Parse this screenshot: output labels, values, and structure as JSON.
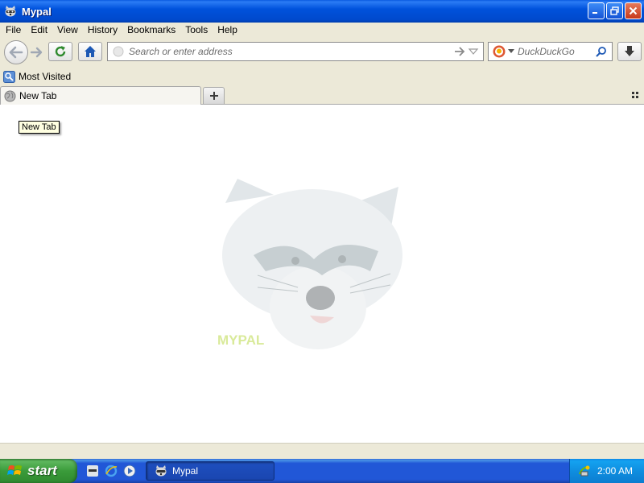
{
  "window": {
    "title": "Mypal"
  },
  "menu": [
    "File",
    "Edit",
    "View",
    "History",
    "Bookmarks",
    "Tools",
    "Help"
  ],
  "urlbar": {
    "placeholder": "Search or enter address"
  },
  "searchbar": {
    "placeholder": "DuckDuckGo"
  },
  "bookmarks": [
    {
      "label": "Most Visited",
      "icon": "bookmark-folder-icon"
    }
  ],
  "tabs": [
    {
      "label": "New Tab",
      "icon": "globe-icon"
    }
  ],
  "tooltip": "New Tab",
  "taskbar": {
    "start_label": "start",
    "task_label": "Mypal",
    "clock": "2:00 AM"
  },
  "colors": {
    "titlebar": "#0052dc",
    "taskbar": "#2157d7",
    "start": "#3a9b3a",
    "chrome": "#ece9d8"
  }
}
